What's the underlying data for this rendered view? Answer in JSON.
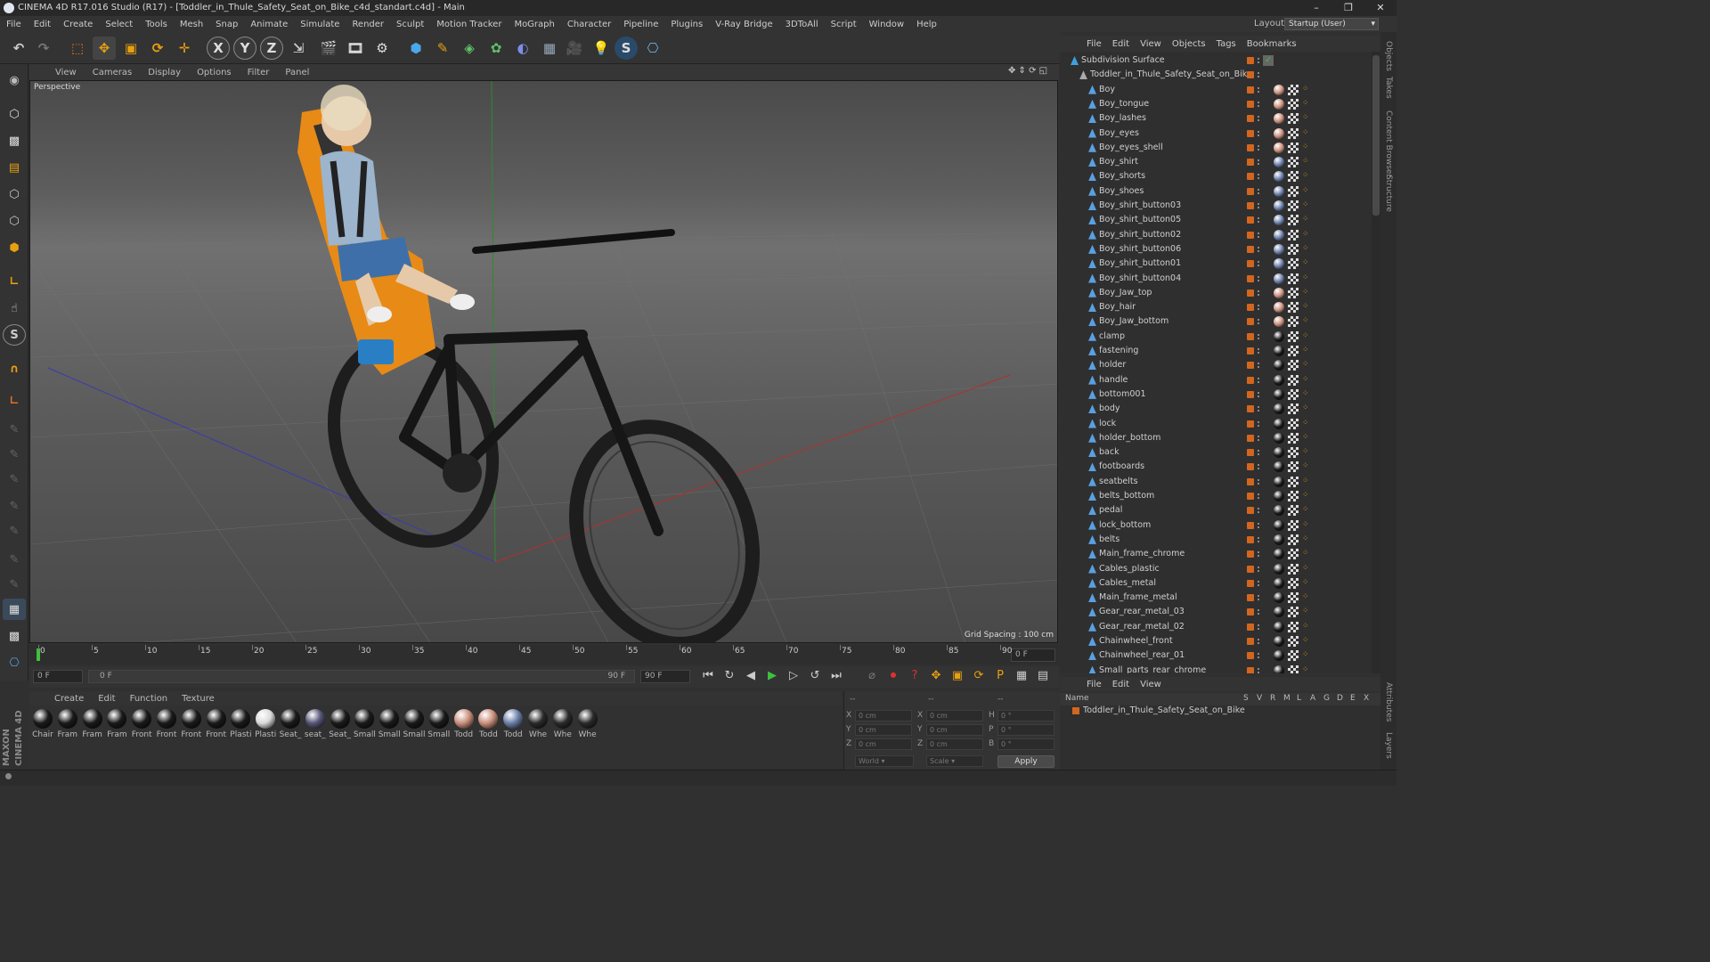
{
  "window": {
    "title": "CINEMA 4D R17.016 Studio (R17) - [Toddler_in_Thule_Safety_Seat_on_Bike_c4d_standart.c4d] - Main",
    "controls": [
      "–",
      "❐",
      "✕"
    ]
  },
  "menu": [
    "File",
    "Edit",
    "Create",
    "Select",
    "Tools",
    "Mesh",
    "Snap",
    "Animate",
    "Simulate",
    "Render",
    "Sculpt",
    "Motion Tracker",
    "MoGraph",
    "Character",
    "Pipeline",
    "Plugins",
    "V-Ray Bridge",
    "3DToAll",
    "Script",
    "Window",
    "Help"
  ],
  "layout": {
    "label": "Layout:",
    "value": "Startup (User)"
  },
  "toolbar": {
    "axis_x": "X",
    "axis_y": "Y",
    "axis_z": "Z",
    "icons": [
      "undo-icon",
      "redo-icon",
      "select-icon",
      "move-icon",
      "scale-icon",
      "rotate-icon",
      "transform-icon",
      "x-axis-icon",
      "y-axis-icon",
      "z-axis-icon",
      "coord-icon",
      "render-view-icon",
      "render-icon",
      "render-settings-icon",
      "cube-icon",
      "pen-icon",
      "subdivision-icon",
      "array-icon",
      "deformer-icon",
      "floor-icon",
      "camera-icon",
      "light-icon",
      "sketch-icon",
      "python-icon"
    ]
  },
  "viewport": {
    "menu": [
      "View",
      "Cameras",
      "Display",
      "Options",
      "Filter",
      "Panel"
    ],
    "label": "Perspective",
    "grid_spacing": "Grid Spacing : 100 cm"
  },
  "timeline": {
    "ticks": [
      "0",
      "5",
      "10",
      "15",
      "20",
      "25",
      "30",
      "35",
      "40",
      "45",
      "50",
      "55",
      "60",
      "65",
      "70",
      "75",
      "80",
      "85",
      "90"
    ],
    "end_field": "0 F",
    "start": "0 F",
    "slider_start": "0 F",
    "slider_end": "90 F",
    "end": "90 F"
  },
  "materials": {
    "menu": [
      "Create",
      "Edit",
      "Function",
      "Texture"
    ],
    "items": [
      {
        "label": "Chair",
        "color": "#1a1a1a"
      },
      {
        "label": "Fram",
        "color": "#1a1a1a"
      },
      {
        "label": "Fram",
        "color": "#1a1a1a"
      },
      {
        "label": "Fram",
        "color": "#1a1a1a"
      },
      {
        "label": "Front",
        "color": "#1a1a1a"
      },
      {
        "label": "Front",
        "color": "#1a1a1a"
      },
      {
        "label": "Front",
        "color": "#1a1a1a"
      },
      {
        "label": "Front",
        "color": "#1a1a1a"
      },
      {
        "label": "Plasti",
        "color": "#1a1a1a"
      },
      {
        "label": "Plasti",
        "color": "#d9d9d9"
      },
      {
        "label": "Seat_",
        "color": "#1a1a1a"
      },
      {
        "label": "seat_",
        "color": "#555577"
      },
      {
        "label": "Seat_",
        "color": "#1a1a1a"
      },
      {
        "label": "Small",
        "color": "#1a1a1a"
      },
      {
        "label": "Small",
        "color": "#1a1a1a"
      },
      {
        "label": "Small",
        "color": "#1a1a1a"
      },
      {
        "label": "Small",
        "color": "#1a1a1a"
      },
      {
        "label": "Todd",
        "color": "#c98f7c"
      },
      {
        "label": "Todd",
        "color": "#c98f7c"
      },
      {
        "label": "Todd",
        "color": "#6a7fa8"
      },
      {
        "label": "Whe",
        "color": "#2a2a2a"
      },
      {
        "label": "Whe",
        "color": "#2a2a2a"
      },
      {
        "label": "Whe",
        "color": "#2a2a2a"
      }
    ]
  },
  "coords": {
    "header": [
      "--",
      "--",
      "--"
    ],
    "rows": [
      {
        "a": "X",
        "av": "0 cm",
        "b": "X",
        "bv": "0 cm",
        "c": "H",
        "cv": "0 °"
      },
      {
        "a": "Y",
        "av": "0 cm",
        "b": "Y",
        "bv": "0 cm",
        "c": "P",
        "cv": "0 °"
      },
      {
        "a": "Z",
        "av": "0 cm",
        "b": "Z",
        "bv": "0 cm",
        "c": "B",
        "cv": "0 °"
      }
    ],
    "mode1": "World",
    "mode2": "Scale",
    "apply": "Apply"
  },
  "objects": {
    "menu": [
      "File",
      "Edit",
      "View",
      "Objects",
      "Tags",
      "Bookmarks"
    ],
    "root": "Subdivision Surface",
    "group": "Toddler_in_Thule_Safety_Seat_on_Bike",
    "items": [
      {
        "name": "Boy",
        "tag": "skin"
      },
      {
        "name": "Boy_tongue",
        "tag": "skin"
      },
      {
        "name": "Boy_lashes",
        "tag": "skin"
      },
      {
        "name": "Boy_eyes",
        "tag": "skin"
      },
      {
        "name": "Boy_eyes_shell",
        "tag": "skin"
      },
      {
        "name": "Boy_shirt",
        "tag": "blue"
      },
      {
        "name": "Boy_shorts",
        "tag": "blue"
      },
      {
        "name": "Boy_shoes",
        "tag": "blue"
      },
      {
        "name": "Boy_shirt_button03",
        "tag": "blue"
      },
      {
        "name": "Boy_shirt_button05",
        "tag": "blue"
      },
      {
        "name": "Boy_shirt_button02",
        "tag": "blue"
      },
      {
        "name": "Boy_shirt_button06",
        "tag": "blue"
      },
      {
        "name": "Boy_shirt_button01",
        "tag": "blue"
      },
      {
        "name": "Boy_shirt_button04",
        "tag": "blue"
      },
      {
        "name": "Boy_Jaw_top",
        "tag": "skin"
      },
      {
        "name": "Boy_hair",
        "tag": "skin"
      },
      {
        "name": "Boy_Jaw_bottom",
        "tag": "skin"
      },
      {
        "name": "clamp",
        "tag": "dark"
      },
      {
        "name": "fastening",
        "tag": "dark"
      },
      {
        "name": "holder",
        "tag": "dark"
      },
      {
        "name": "handle",
        "tag": "dark"
      },
      {
        "name": "bottom001",
        "tag": "dark"
      },
      {
        "name": "body",
        "tag": "dark"
      },
      {
        "name": "lock",
        "tag": "dark"
      },
      {
        "name": "holder_bottom",
        "tag": "dark"
      },
      {
        "name": "back",
        "tag": "dark"
      },
      {
        "name": "footboards",
        "tag": "dark"
      },
      {
        "name": "seatbelts",
        "tag": "dark"
      },
      {
        "name": "belts_bottom",
        "tag": "dark"
      },
      {
        "name": "pedal",
        "tag": "dark"
      },
      {
        "name": "lock_bottom",
        "tag": "dark"
      },
      {
        "name": "belts",
        "tag": "dark"
      },
      {
        "name": "Main_frame_chrome",
        "tag": "dark"
      },
      {
        "name": "Cables_plastic",
        "tag": "dark"
      },
      {
        "name": "Cables_metal",
        "tag": "dark"
      },
      {
        "name": "Main_frame_metal",
        "tag": "dark"
      },
      {
        "name": "Gear_rear_metal_03",
        "tag": "dark"
      },
      {
        "name": "Gear_rear_metal_02",
        "tag": "dark"
      },
      {
        "name": "Chainwheel_front",
        "tag": "dark"
      },
      {
        "name": "Chainwheel_rear_01",
        "tag": "dark"
      },
      {
        "name": "Small_parts_rear_chrome",
        "tag": "dark"
      }
    ]
  },
  "layers": {
    "menu": [
      "File",
      "Edit",
      "View"
    ],
    "headers": [
      "Name",
      "S",
      "V",
      "R",
      "M",
      "L",
      "A",
      "G",
      "D",
      "E",
      "X"
    ],
    "row": "Toddler_in_Thule_Safety_Seat_on_Bike"
  },
  "sidetabs": [
    "Objects",
    "Takes",
    "Content Browser",
    "Structure",
    "Attributes",
    "Layers"
  ],
  "brand": {
    "maxon": "MAXON",
    "product": "CINEMA 4D"
  }
}
